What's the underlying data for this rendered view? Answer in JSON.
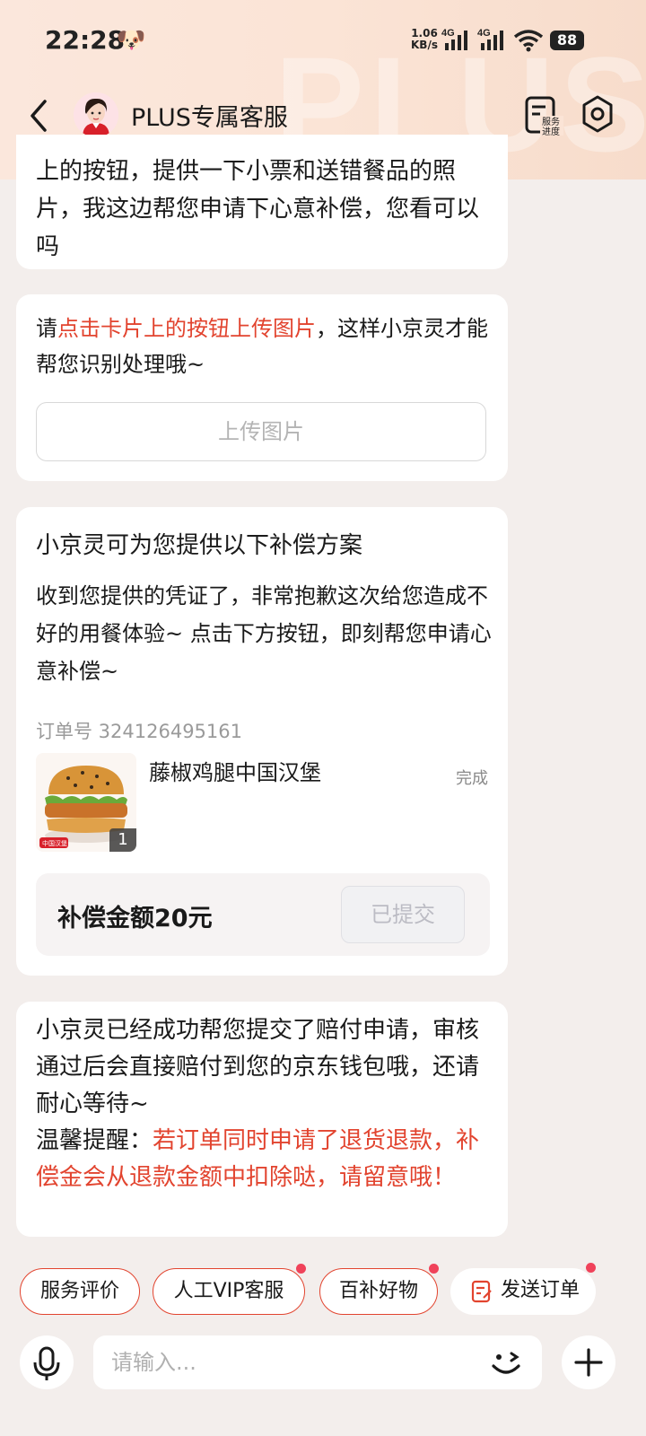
{
  "status_bar": {
    "time": "22:28",
    "emoji": "🐶",
    "net_speed_value": "1.06",
    "net_speed_unit": "KB/s",
    "battery": "88"
  },
  "header": {
    "title": "PLUS专属客服",
    "watermark": "PLUS",
    "progress_label_line1": "服务",
    "progress_label_line2": "进度"
  },
  "messages": {
    "m1_text": "上的按钮，提供一下小票和送错餐品的照片，我这边帮您申请下心意补偿，您看可以吗",
    "m2_prefix": "请",
    "m2_highlight": "点击卡片上的按钮上传图片",
    "m2_suffix": "，这样小京灵才能帮您识别处理哦~",
    "m2_button": "上传图片",
    "m3_title": "小京灵可为您提供以下补偿方案",
    "m3_body": "收到您提供的凭证了，非常抱歉这次给您造成不好的用餐体验~ 点击下方按钮，即刻帮您申请心意补偿~",
    "m3_order_label": "订单号 324126495161",
    "m3_food_name": "藤椒鸡腿中国汉堡",
    "m3_food_qty": "1",
    "m3_food_tag": "中国汉堡",
    "m3_order_status": "完成",
    "m3_comp_label": "补偿金额20元",
    "m3_comp_button": "已提交",
    "m4_text": "小京灵已经成功帮您提交了赔付申请，审核通过后会直接赔付到您的京东钱包哦，还请耐心等待~",
    "m4_tip_label": "温馨提醒：",
    "m4_tip_text": "若订单同时申请了退货退款，补偿金会从退款金额中扣除哒，请留意哦！"
  },
  "quick_actions": [
    {
      "label": "服务评价"
    },
    {
      "label": "人工VIP客服"
    },
    {
      "label": "百补好物"
    },
    {
      "label": "发送订单"
    }
  ],
  "input": {
    "placeholder": "请输入..."
  },
  "colors": {
    "accent_red": "#e2442f",
    "badge_dot": "#f0425a"
  }
}
